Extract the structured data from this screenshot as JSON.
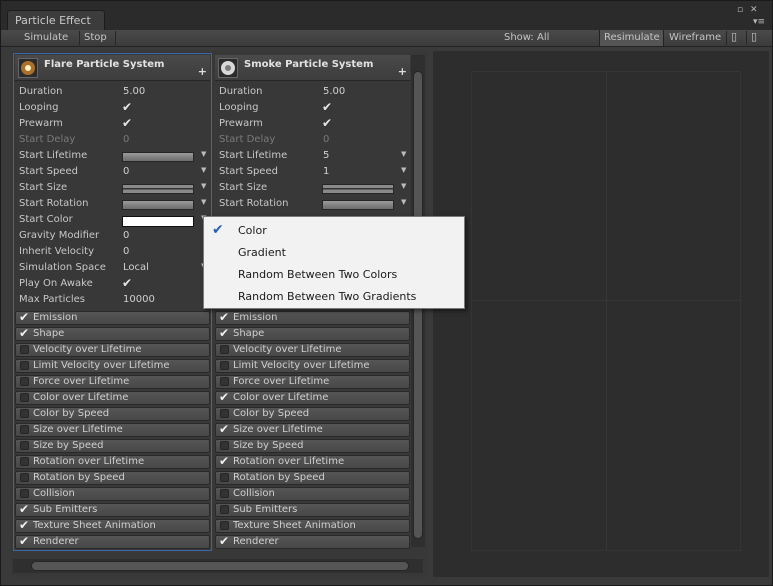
{
  "window": {
    "tab_title": "Particle Effect",
    "controls": {
      "maximize": "▫",
      "close": "✕",
      "menu": "▾≡"
    }
  },
  "toolbar": {
    "simulate": "Simulate",
    "stop": "Stop",
    "show": "Show: All",
    "resimulate": "Resimulate",
    "resimulate_pressed": true,
    "wireframe": "Wireframe"
  },
  "systems": [
    {
      "name": "Flare Particle System",
      "icon": "flare-icon",
      "selected": true,
      "props": [
        {
          "label": "Duration",
          "type": "value",
          "value": "5.00"
        },
        {
          "label": "Looping",
          "type": "check"
        },
        {
          "label": "Prewarm",
          "type": "check"
        },
        {
          "label": "Start Delay",
          "type": "value",
          "value": "0",
          "disabled": true
        },
        {
          "label": "Start Lifetime",
          "type": "curve",
          "arrow": "▼"
        },
        {
          "label": "Start Speed",
          "type": "value",
          "value": "0",
          "arrow": "▼"
        },
        {
          "label": "Start Size",
          "type": "curve2",
          "arrow": "▼"
        },
        {
          "label": "Start Rotation",
          "type": "curve",
          "arrow": "▼"
        },
        {
          "label": "Start Color",
          "type": "color",
          "arrow": "▼"
        },
        {
          "label": "Gravity Modifier",
          "type": "value",
          "value": "0"
        },
        {
          "label": "Inherit Velocity",
          "type": "value",
          "value": "0"
        },
        {
          "label": "Simulation Space",
          "type": "value",
          "value": "Local",
          "arrow": "▼"
        },
        {
          "label": "Play On Awake",
          "type": "check"
        },
        {
          "label": "Max Particles",
          "type": "value",
          "value": "10000"
        }
      ],
      "modules": [
        {
          "label": "Emission",
          "enabled": true
        },
        {
          "label": "Shape",
          "enabled": true
        },
        {
          "label": "Velocity over Lifetime",
          "enabled": false
        },
        {
          "label": "Limit Velocity over Lifetime",
          "enabled": false
        },
        {
          "label": "Force over Lifetime",
          "enabled": false
        },
        {
          "label": "Color over Lifetime",
          "enabled": false
        },
        {
          "label": "Color by Speed",
          "enabled": false
        },
        {
          "label": "Size over Lifetime",
          "enabled": false
        },
        {
          "label": "Size by Speed",
          "enabled": false
        },
        {
          "label": "Rotation over Lifetime",
          "enabled": false
        },
        {
          "label": "Rotation by Speed",
          "enabled": false
        },
        {
          "label": "Collision",
          "enabled": false
        },
        {
          "label": "Sub Emitters",
          "enabled": true
        },
        {
          "label": "Texture Sheet Animation",
          "enabled": true
        },
        {
          "label": "Renderer",
          "enabled": true
        }
      ]
    },
    {
      "name": "Smoke Particle System",
      "icon": "smoke-icon",
      "selected": false,
      "props": [
        {
          "label": "Duration",
          "type": "value",
          "value": "5.00"
        },
        {
          "label": "Looping",
          "type": "check"
        },
        {
          "label": "Prewarm",
          "type": "check"
        },
        {
          "label": "Start Delay",
          "type": "value",
          "value": "0",
          "disabled": true
        },
        {
          "label": "Start Lifetime",
          "type": "value",
          "value": "5",
          "arrow": "▼"
        },
        {
          "label": "Start Speed",
          "type": "value",
          "value": "1",
          "arrow": "▼"
        },
        {
          "label": "Start Size",
          "type": "curve2",
          "arrow": "▼"
        },
        {
          "label": "Start Rotation",
          "type": "curve",
          "arrow": "▼"
        }
      ],
      "modules": [
        {
          "label": "Emission",
          "enabled": true
        },
        {
          "label": "Shape",
          "enabled": true
        },
        {
          "label": "Velocity over Lifetime",
          "enabled": false
        },
        {
          "label": "Limit Velocity over Lifetime",
          "enabled": false
        },
        {
          "label": "Force over Lifetime",
          "enabled": false
        },
        {
          "label": "Color over Lifetime",
          "enabled": true
        },
        {
          "label": "Color by Speed",
          "enabled": false
        },
        {
          "label": "Size over Lifetime",
          "enabled": true
        },
        {
          "label": "Size by Speed",
          "enabled": false
        },
        {
          "label": "Rotation over Lifetime",
          "enabled": true
        },
        {
          "label": "Rotation by Speed",
          "enabled": false
        },
        {
          "label": "Collision",
          "enabled": false
        },
        {
          "label": "Sub Emitters",
          "enabled": false
        },
        {
          "label": "Texture Sheet Animation",
          "enabled": false
        },
        {
          "label": "Renderer",
          "enabled": true
        }
      ]
    }
  ],
  "dropdown": {
    "items": [
      {
        "label": "Color",
        "checked": true
      },
      {
        "label": "Gradient",
        "checked": false
      },
      {
        "label": "Random Between Two Colors",
        "checked": false
      },
      {
        "label": "Random Between Two Gradients",
        "checked": false
      }
    ]
  },
  "icons": {
    "check": "✔",
    "plus": "+",
    "pane_toggle": "▯"
  },
  "colors": {
    "selection_outline": "#3a67a8",
    "start_color": "#ffffff",
    "dropdown_check": "#2a5fb0"
  }
}
